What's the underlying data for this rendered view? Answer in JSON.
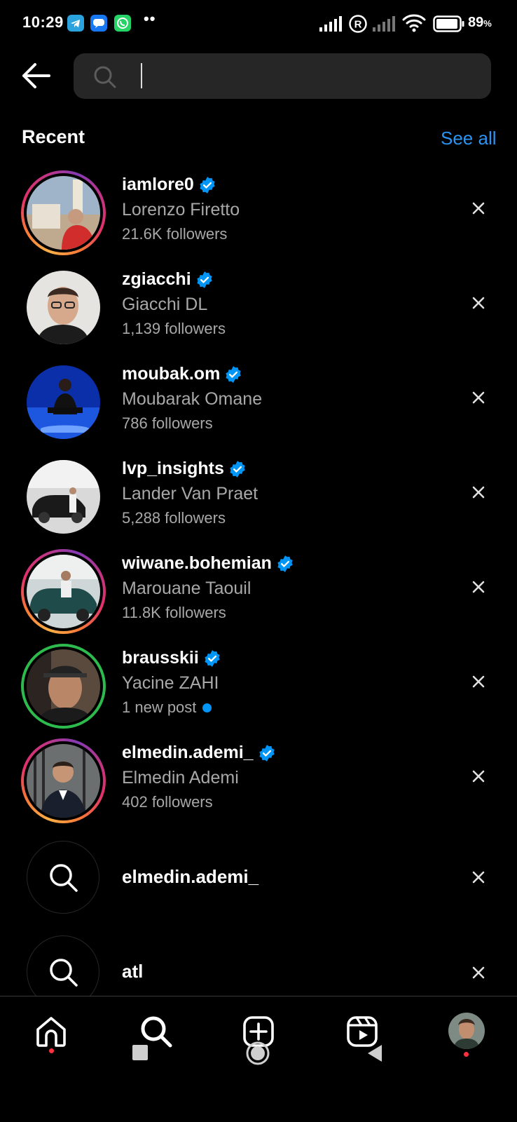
{
  "status_bar": {
    "time": "10:29",
    "dots": "••",
    "battery_pct": "89",
    "battery_unit": "%"
  },
  "search": {
    "placeholder": "",
    "value": ""
  },
  "recent": {
    "title": "Recent",
    "see_all": "See all"
  },
  "accounts": [
    {
      "username": "iamlore0",
      "full_name": "Lorenzo Firetto",
      "meta": "21.6K followers",
      "verified": true,
      "ring": "story"
    },
    {
      "username": "zgiacchi",
      "full_name": "Giacchi DL",
      "meta": "1,139 followers",
      "verified": true,
      "ring": "none"
    },
    {
      "username": "moubak.om",
      "full_name": "Moubarak Omane",
      "meta": "786 followers",
      "verified": true,
      "ring": "none"
    },
    {
      "username": "lvp_insights",
      "full_name": "Lander Van Praet",
      "meta": "5,288 followers",
      "verified": true,
      "ring": "none"
    },
    {
      "username": "wiwane.bohemian",
      "full_name": "Marouane Taouil",
      "meta": "11.8K followers",
      "verified": true,
      "ring": "story"
    },
    {
      "username": "brausskii",
      "full_name": "Yacine ZAHI",
      "meta": "1 new post",
      "verified": true,
      "ring": "close-friends"
    },
    {
      "username": "elmedin.ademi_",
      "full_name": "Elmedin Ademi",
      "meta": "402 followers",
      "verified": true,
      "ring": "story"
    }
  ],
  "queries": [
    {
      "text": "elmedin.ademi_"
    },
    {
      "text": "atl"
    }
  ],
  "colors": {
    "link": "#2b93f1",
    "verified": "#0095f6",
    "notification_dot": "#ff3040",
    "close_friends_ring": "#2dbb4d"
  },
  "nav": [
    "home-icon",
    "search-icon",
    "create-icon",
    "reels-icon",
    "profile-avatar"
  ]
}
